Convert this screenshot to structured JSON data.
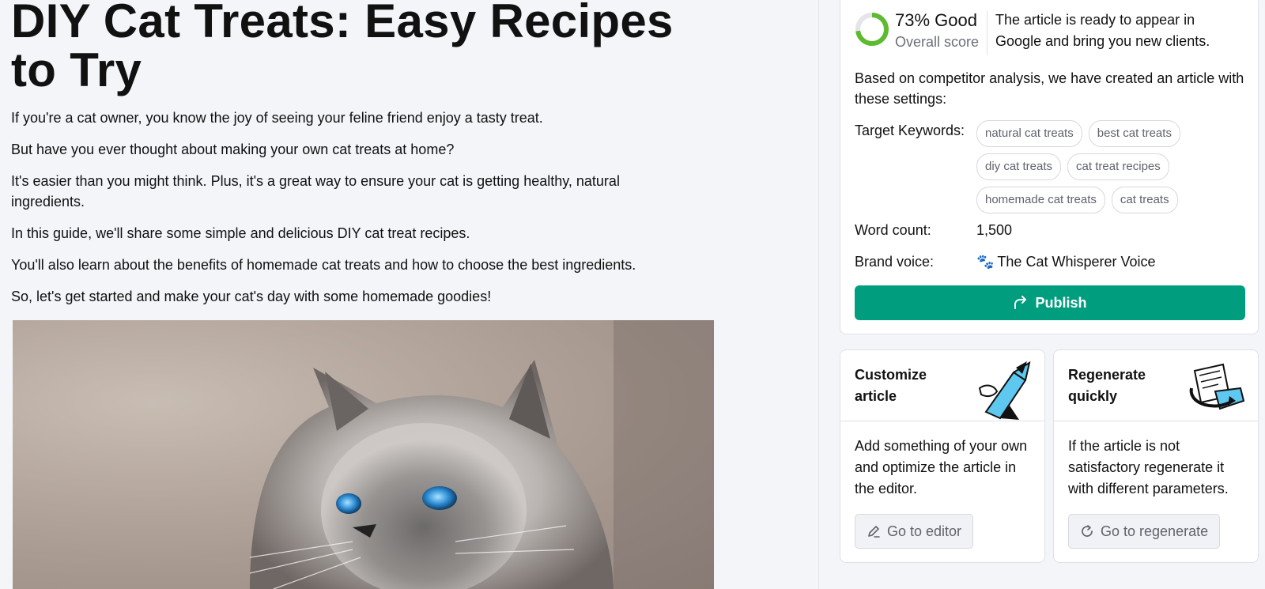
{
  "article": {
    "title": "DIY Cat Treats: Easy Recipes to Try",
    "paragraphs": [
      "If you're a cat owner, you know the joy of seeing your feline friend enjoy a tasty treat.",
      "But have you ever thought about making your own cat treats at home?",
      "It's easier than you might think. Plus, it's a great way to ensure your cat is getting healthy, natural ingredients.",
      "In this guide, we'll share some simple and delicious DIY cat treat recipes.",
      "You'll also learn about the benefits of homemade cat treats and how to choose the best ingredients.",
      "So, let's get started and make your cat's day with some homemade goodies!"
    ]
  },
  "score": {
    "value": "73% Good",
    "label": "Overall score",
    "percent": 73,
    "description": "The article is ready to appear in Google and bring you new clients."
  },
  "settings": {
    "intro": "Based on competitor analysis, we have created an article with these settings:",
    "keywords_label": "Target Keywords:",
    "keywords": [
      "natural cat treats",
      "best cat treats",
      "diy cat treats",
      "cat treat recipes",
      "homemade cat treats",
      "cat treats"
    ],
    "word_count_label": "Word count:",
    "word_count": "1,500",
    "brand_voice_label": "Brand voice:",
    "brand_voice": "The Cat Whisperer Voice"
  },
  "publish_label": "Publish",
  "customize": {
    "title": "Customize article",
    "body": "Add something of your own and optimize the article in the editor.",
    "button": "Go to editor"
  },
  "regenerate": {
    "title": "Regenerate quickly",
    "body": "If the article is not satisfactory regenerate it with different parameters.",
    "button": "Go to regenerate"
  },
  "colors": {
    "accent": "#009e7e",
    "score_ring": "#5dbb2f",
    "illustration_blue": "#5ec8f0"
  }
}
